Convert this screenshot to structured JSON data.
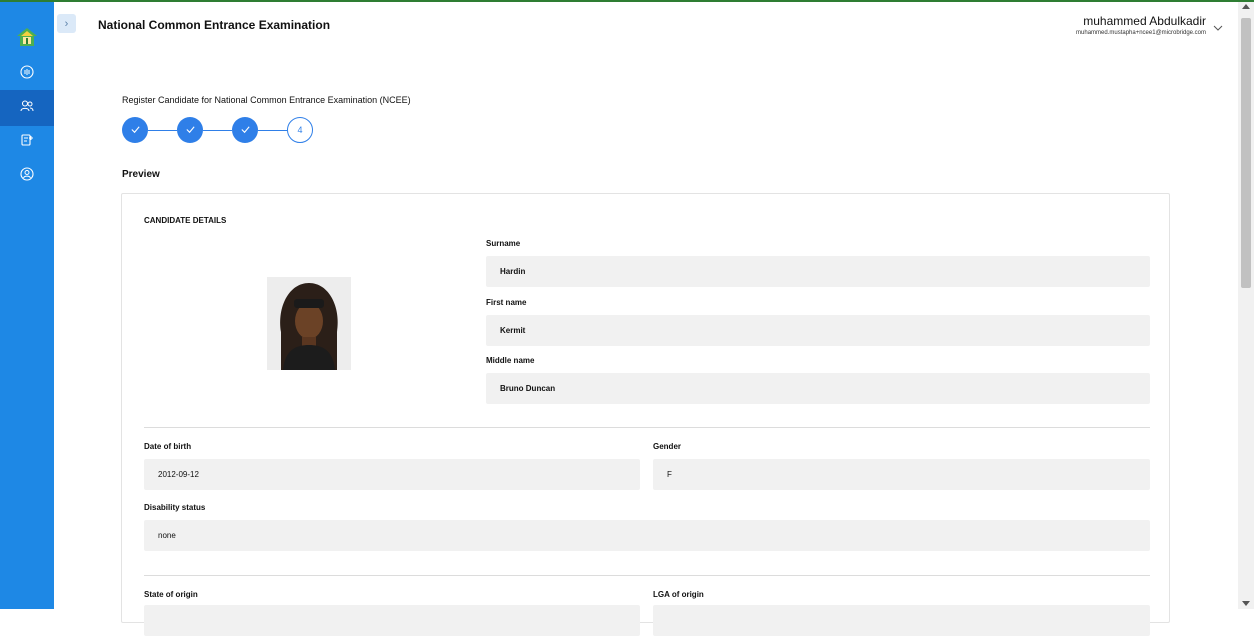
{
  "app": {
    "title": "National Common Entrance Examination"
  },
  "user": {
    "name": "muhammed Abdulkadir",
    "email": "muhammed.mustapha+ncee1@microbridge.com"
  },
  "sidebar": {
    "items": [
      {
        "icon": "dashboard-icon"
      },
      {
        "icon": "users-icon",
        "active": true
      },
      {
        "icon": "exam-icon"
      },
      {
        "icon": "account-icon"
      }
    ]
  },
  "page": {
    "heading": "Register Candidate for National Common Entrance Examination (NCEE)"
  },
  "steps": [
    {
      "status": "done",
      "label": ""
    },
    {
      "status": "done",
      "label": ""
    },
    {
      "status": "done",
      "label": ""
    },
    {
      "status": "current",
      "label": "4"
    }
  ],
  "preview": {
    "title": "Preview",
    "section": "CANDIDATE DETAILS",
    "fields": {
      "surname": {
        "label": "Surname",
        "value": "Hardin"
      },
      "first_name": {
        "label": "First name",
        "value": "Kermit"
      },
      "middle_name": {
        "label": "Middle name",
        "value": "Bruno Duncan"
      },
      "dob": {
        "label": "Date of birth",
        "value": "2012-09-12"
      },
      "gender": {
        "label": "Gender",
        "value": "F"
      },
      "disability": {
        "label": "Disability status",
        "value": "none"
      },
      "state_origin": {
        "label": "State of origin",
        "value": ""
      },
      "lga_origin": {
        "label": "LGA of origin",
        "value": ""
      }
    }
  },
  "colors": {
    "sidebar": "#1e88e5",
    "sidebar_active": "#1565c0",
    "accent": "#2f7fe8",
    "topline": "#2e7d32",
    "field_bg": "#f1f1f1"
  }
}
